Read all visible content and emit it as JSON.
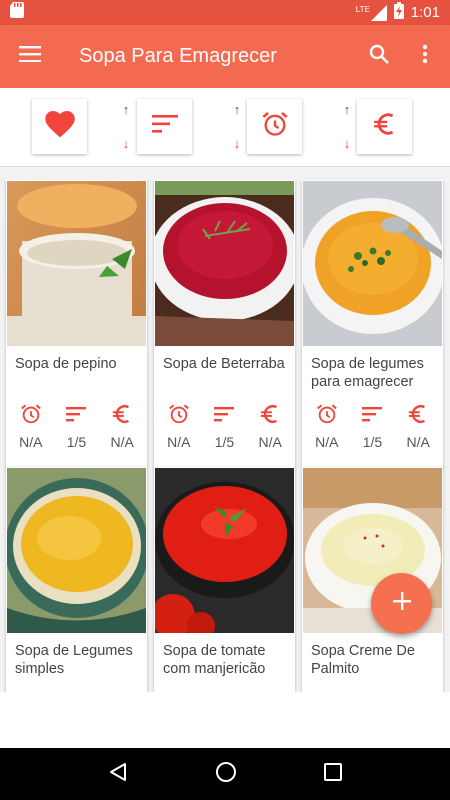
{
  "status_bar": {
    "network": "LTE",
    "time": "1:01"
  },
  "app_bar": {
    "title": "Sopa Para Emagrecer"
  },
  "sort_bar": {
    "up_arrow": "↑",
    "down_arrow": "↓"
  },
  "recipes": [
    {
      "name": "Sopa de pepino",
      "time": "N/A",
      "difficulty": "1/5",
      "cost": "N/A"
    },
    {
      "name": "Sopa de Beterraba",
      "time": "N/A",
      "difficulty": "1/5",
      "cost": "N/A"
    },
    {
      "name": "Sopa de legumes para emagrecer",
      "time": "N/A",
      "difficulty": "1/5",
      "cost": "N/A"
    },
    {
      "name": "Sopa de Legumes simples"
    },
    {
      "name": "Sopa de tomate com manjericão"
    },
    {
      "name": "Sopa Creme De Palmito"
    }
  ],
  "colors": {
    "primary": "#f46a50",
    "status": "#e5523f",
    "accent_red": "#f0453a"
  }
}
